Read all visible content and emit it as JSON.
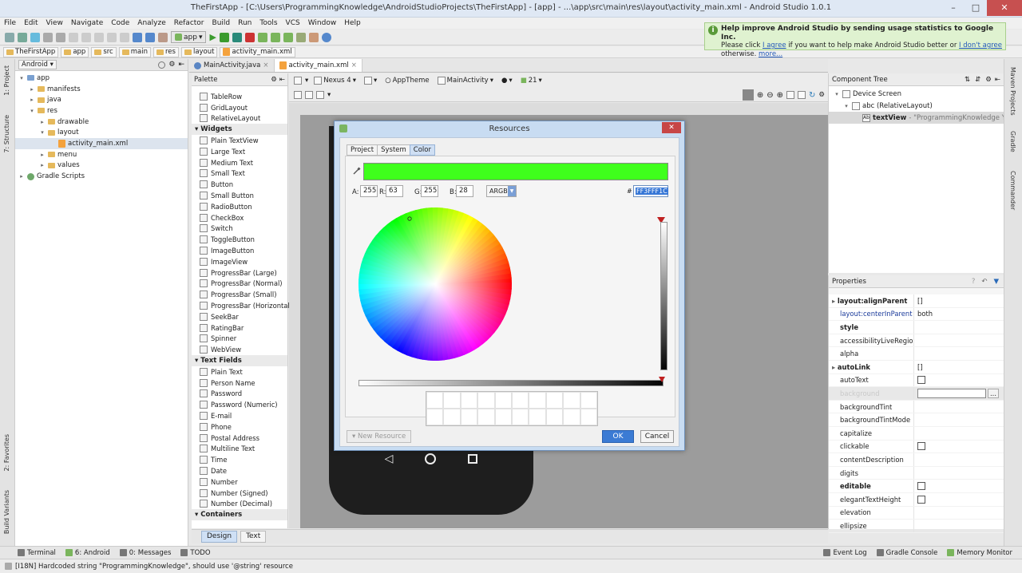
{
  "window": {
    "title": "TheFirstApp - [C:\\Users\\ProgrammingKnowledge\\AndroidStudioProjects\\TheFirstApp] - [app] - ...\\app\\src\\main\\res\\layout\\activity_main.xml - Android Studio 1.0.1"
  },
  "menu": [
    "File",
    "Edit",
    "View",
    "Navigate",
    "Code",
    "Analyze",
    "Refactor",
    "Build",
    "Run",
    "Tools",
    "VCS",
    "Window",
    "Help"
  ],
  "toolbar": {
    "run_config": "app"
  },
  "breadcrumb": [
    "TheFirstApp",
    "app",
    "src",
    "main",
    "res",
    "layout",
    "activity_main.xml"
  ],
  "notification": {
    "title": "Help improve Android Studio by sending usage statistics to Google Inc.",
    "line1_pre": "Please click ",
    "agree": "I agree",
    "line1_mid": " if you want to help make Android Studio better or ",
    "disagree": "I don't agree",
    "line2_pre": "otherwise. ",
    "more": "more..."
  },
  "left_tabs": [
    "1: Project",
    "7: Structure",
    "2: Favorites",
    "Build Variants"
  ],
  "right_tabs": [
    "Maven Projects",
    "Gradle",
    "Commander"
  ],
  "project": {
    "view": "Android",
    "tree": [
      {
        "label": "app",
        "indent": 0,
        "arrow": "▾",
        "type": "module"
      },
      {
        "label": "manifests",
        "indent": 1,
        "arrow": "▸",
        "type": "folder"
      },
      {
        "label": "java",
        "indent": 1,
        "arrow": "▸",
        "type": "folder"
      },
      {
        "label": "res",
        "indent": 1,
        "arrow": "▾",
        "type": "folder"
      },
      {
        "label": "drawable",
        "indent": 2,
        "arrow": "▸",
        "type": "folder"
      },
      {
        "label": "layout",
        "indent": 2,
        "arrow": "▾",
        "type": "folder"
      },
      {
        "label": "activity_main.xml",
        "indent": 3,
        "arrow": "",
        "type": "xml",
        "selected": true
      },
      {
        "label": "menu",
        "indent": 2,
        "arrow": "▸",
        "type": "folder"
      },
      {
        "label": "values",
        "indent": 2,
        "arrow": "▸",
        "type": "folder"
      },
      {
        "label": "Gradle Scripts",
        "indent": 0,
        "arrow": "▸",
        "type": "gradle"
      }
    ]
  },
  "editor_tabs": [
    {
      "label": "MainActivity.java",
      "type": "java",
      "active": false
    },
    {
      "label": "activity_main.xml",
      "type": "xml",
      "active": true
    }
  ],
  "palette": {
    "title": "Palette",
    "items": [
      {
        "label": "TableRow",
        "group": false
      },
      {
        "label": "GridLayout",
        "group": false
      },
      {
        "label": "RelativeLayout",
        "group": false
      },
      {
        "label": "Widgets",
        "group": true
      },
      {
        "label": "Plain TextView",
        "group": false
      },
      {
        "label": "Large Text",
        "group": false
      },
      {
        "label": "Medium Text",
        "group": false
      },
      {
        "label": "Small Text",
        "group": false
      },
      {
        "label": "Button",
        "group": false
      },
      {
        "label": "Small Button",
        "group": false
      },
      {
        "label": "RadioButton",
        "group": false
      },
      {
        "label": "CheckBox",
        "group": false
      },
      {
        "label": "Switch",
        "group": false
      },
      {
        "label": "ToggleButton",
        "group": false
      },
      {
        "label": "ImageButton",
        "group": false
      },
      {
        "label": "ImageView",
        "group": false
      },
      {
        "label": "ProgressBar (Large)",
        "group": false
      },
      {
        "label": "ProgressBar (Normal)",
        "group": false
      },
      {
        "label": "ProgressBar (Small)",
        "group": false
      },
      {
        "label": "ProgressBar (Horizontal)",
        "group": false
      },
      {
        "label": "SeekBar",
        "group": false
      },
      {
        "label": "RatingBar",
        "group": false
      },
      {
        "label": "Spinner",
        "group": false
      },
      {
        "label": "WebView",
        "group": false
      },
      {
        "label": "Text Fields",
        "group": true
      },
      {
        "label": "Plain Text",
        "group": false
      },
      {
        "label": "Person Name",
        "group": false
      },
      {
        "label": "Password",
        "group": false
      },
      {
        "label": "Password (Numeric)",
        "group": false
      },
      {
        "label": "E-mail",
        "group": false
      },
      {
        "label": "Phone",
        "group": false
      },
      {
        "label": "Postal Address",
        "group": false
      },
      {
        "label": "Multiline Text",
        "group": false
      },
      {
        "label": "Time",
        "group": false
      },
      {
        "label": "Date",
        "group": false
      },
      {
        "label": "Number",
        "group": false
      },
      {
        "label": "Number (Signed)",
        "group": false
      },
      {
        "label": "Number (Decimal)",
        "group": false
      },
      {
        "label": "Containers",
        "group": true
      }
    ]
  },
  "canvas_toolbar": {
    "device": "Nexus 4",
    "theme": "AppTheme",
    "activity": "MainActivity",
    "api": "21"
  },
  "design_tabs": [
    "Design",
    "Text"
  ],
  "component_tree": {
    "title": "Component Tree",
    "rows": [
      {
        "label": "Device Screen",
        "extra": ""
      },
      {
        "label": "abc (RelativeLayout)",
        "extra": ""
      },
      {
        "label": "textView",
        "extra": " - \"ProgrammingKnowledge Youtu"
      }
    ]
  },
  "properties": {
    "title": "Properties",
    "rows": [
      {
        "name": "layout:alignParent",
        "value": "[]",
        "style": "expand"
      },
      {
        "name": "layout:centerInParent",
        "value": "both",
        "style": "blue"
      },
      {
        "name": "style",
        "value": "",
        "style": "strong"
      },
      {
        "name": "accessibilityLiveRegion",
        "value": "",
        "style": ""
      },
      {
        "name": "alpha",
        "value": "",
        "style": ""
      },
      {
        "name": "autoLink",
        "value": "[]",
        "style": "expand"
      },
      {
        "name": "autoText",
        "value": "",
        "style": "check"
      },
      {
        "name": "background",
        "value": "",
        "style": "selected"
      },
      {
        "name": "backgroundTint",
        "value": "",
        "style": ""
      },
      {
        "name": "backgroundTintMode",
        "value": "",
        "style": ""
      },
      {
        "name": "capitalize",
        "value": "",
        "style": ""
      },
      {
        "name": "clickable",
        "value": "",
        "style": "check"
      },
      {
        "name": "contentDescription",
        "value": "",
        "style": ""
      },
      {
        "name": "digits",
        "value": "",
        "style": ""
      },
      {
        "name": "editable",
        "value": "",
        "style": "strongcheck"
      },
      {
        "name": "elegantTextHeight",
        "value": "",
        "style": "check"
      },
      {
        "name": "elevation",
        "value": "",
        "style": ""
      },
      {
        "name": "ellipsize",
        "value": "",
        "style": ""
      }
    ]
  },
  "dialog": {
    "title": "Resources",
    "tabs": [
      "Project",
      "System",
      "Color"
    ],
    "active_tab": "Color",
    "labels": {
      "a": "A:",
      "r": "R:",
      "g": "G:",
      "b": "B:",
      "hash": "#"
    },
    "a": "255",
    "r": "63",
    "g": "255",
    "b": "28",
    "mode": "ARGB",
    "hex": "FF3FFF1C",
    "selected_color": "#3FFF1C",
    "new_resource": "New Resource",
    "ok": "OK",
    "cancel": "Cancel"
  },
  "bottom_tools": [
    "Terminal",
    "6: Android",
    "0: Messages",
    "TODO",
    "Event Log",
    "Gradle Console",
    "Memory Monitor"
  ],
  "status": "[I18N] Hardcoded string \"ProgrammingKnowledge\", should use '@string' resource"
}
